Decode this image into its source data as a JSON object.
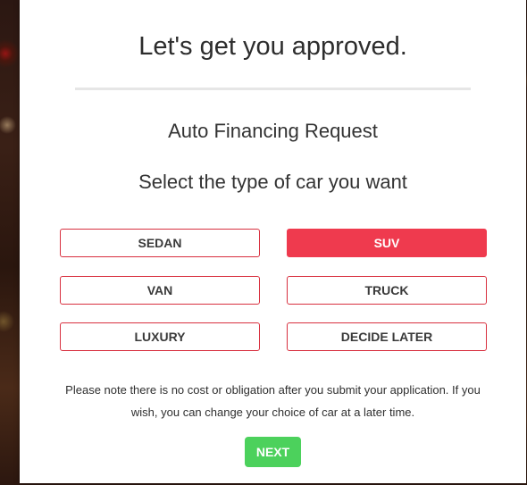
{
  "modal": {
    "title": "Let's get you approved.",
    "subtitle": "Auto Financing Request",
    "question": "Select the type of car you want",
    "car_types": [
      {
        "label": "SEDAN",
        "selected": false
      },
      {
        "label": "SUV",
        "selected": true
      },
      {
        "label": "VAN",
        "selected": false
      },
      {
        "label": "TRUCK",
        "selected": false
      },
      {
        "label": "LUXURY",
        "selected": false
      },
      {
        "label": "DECIDE LATER",
        "selected": false
      }
    ],
    "note": "Please note there is no cost or obligation after you submit your application. If you wish, you can change your choice of car at a later time.",
    "next_label": "NEXT"
  },
  "colors": {
    "accent": "#ef3a4e",
    "button_border": "#d8303f",
    "next_button": "#4cd15c"
  }
}
